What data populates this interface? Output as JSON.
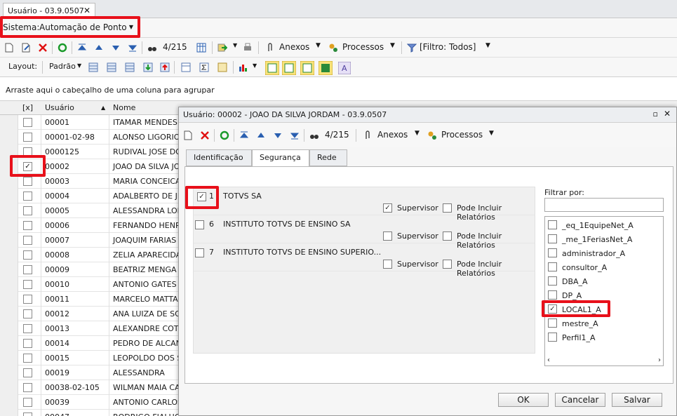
{
  "tab": {
    "title": "Usuário - 03.9.0507",
    "close": "✕"
  },
  "sistema": {
    "label": "Sistema:",
    "value": "Automação de Ponto"
  },
  "toolbar1": {
    "counter": "4/215",
    "anexos": "Anexos",
    "processos": "Processos",
    "filtro": "[Filtro: Todos]"
  },
  "toolbar2": {
    "layout": "Layout:",
    "padrao": "Padrão"
  },
  "group_hint": "Arraste aqui o cabeçalho de uma coluna para agrupar",
  "grid": {
    "headers": {
      "check": "[x]",
      "usuario": "Usuário",
      "nome": "Nome"
    },
    "rows": [
      {
        "u": "00001",
        "n": "ITAMAR MENDES D",
        "c": false
      },
      {
        "u": "00001-02-98",
        "n": "ALONSO LIGORIO I",
        "c": false
      },
      {
        "u": "0000125",
        "n": "RUDIVAL JOSE DOS",
        "c": false
      },
      {
        "u": "00002",
        "n": "JOAO DA SILVA JO",
        "c": true
      },
      {
        "u": "00003",
        "n": "MARIA CONCEICAO",
        "c": false
      },
      {
        "u": "00004",
        "n": "ADALBERTO DE JES",
        "c": false
      },
      {
        "u": "00005",
        "n": "ALESSANDRA LOPE",
        "c": false
      },
      {
        "u": "00006",
        "n": "FERNANDO HENRIC",
        "c": false
      },
      {
        "u": "00007",
        "n": "JOAQUIM FARIAS I",
        "c": false
      },
      {
        "u": "00008",
        "n": "ZELIA APARECIDA",
        "c": false
      },
      {
        "u": "00009",
        "n": "BEATRIZ MENGA",
        "c": false
      },
      {
        "u": "00010",
        "n": "ANTONIO GATES B",
        "c": false
      },
      {
        "u": "00011",
        "n": "MARCELO MATTAR",
        "c": false
      },
      {
        "u": "00012",
        "n": "ANA LUIZA  DE SOU",
        "c": false
      },
      {
        "u": "00013",
        "n": "ALEXANDRE COTTA",
        "c": false
      },
      {
        "u": "00014",
        "n": "PEDRO DE ALCANT",
        "c": false
      },
      {
        "u": "00015",
        "n": "LEOPOLDO DOS SA",
        "c": false
      },
      {
        "u": "00019",
        "n": "ALESSANDRA",
        "c": false
      },
      {
        "u": "00038-02-105",
        "n": "WILMAN MAIA CAB",
        "c": false
      },
      {
        "u": "00039",
        "n": "ANTONIO CARLOS",
        "c": false
      },
      {
        "u": "00047",
        "n": "RODRIGO FIALHO FARRICHELLO",
        "c": false
      }
    ]
  },
  "dialog": {
    "title": "Usuário: 00002 - JOAO DA SILVA JORDAM - 03.9.0507",
    "counter": "4/215",
    "anexos": "Anexos",
    "processos": "Processos",
    "tabs": [
      "Identificação",
      "Segurança",
      "Rede"
    ],
    "companies": [
      {
        "num": "1",
        "name": "TOTVS SA",
        "checked": true,
        "supervisor": true
      },
      {
        "num": "6",
        "name": "INSTITUTO TOTVS DE ENSINO SA",
        "checked": false,
        "supervisor": false
      },
      {
        "num": "7",
        "name": "INSTITUTO TOTVS DE ENSINO SUPERIO...",
        "checked": false,
        "supervisor": false
      }
    ],
    "supervisor_label": "Supervisor",
    "reports_label": "Pode Incluir Relatórios",
    "filter_label": "Filtrar por:",
    "filter_value": "",
    "profiles": [
      {
        "name": "_eq_1EquipeNet_A",
        "checked": false
      },
      {
        "name": "_me_1FeriasNet_A",
        "checked": false
      },
      {
        "name": "administrador_A",
        "checked": false
      },
      {
        "name": "consultor_A",
        "checked": false
      },
      {
        "name": "DBA_A",
        "checked": false
      },
      {
        "name": "DP_A",
        "checked": false
      },
      {
        "name": "LOCAL1_A",
        "checked": true
      },
      {
        "name": "mestre_A",
        "checked": false
      },
      {
        "name": "Perfil1_A",
        "checked": false
      }
    ],
    "ok": "OK",
    "cancel": "Cancelar",
    "save": "Salvar"
  }
}
